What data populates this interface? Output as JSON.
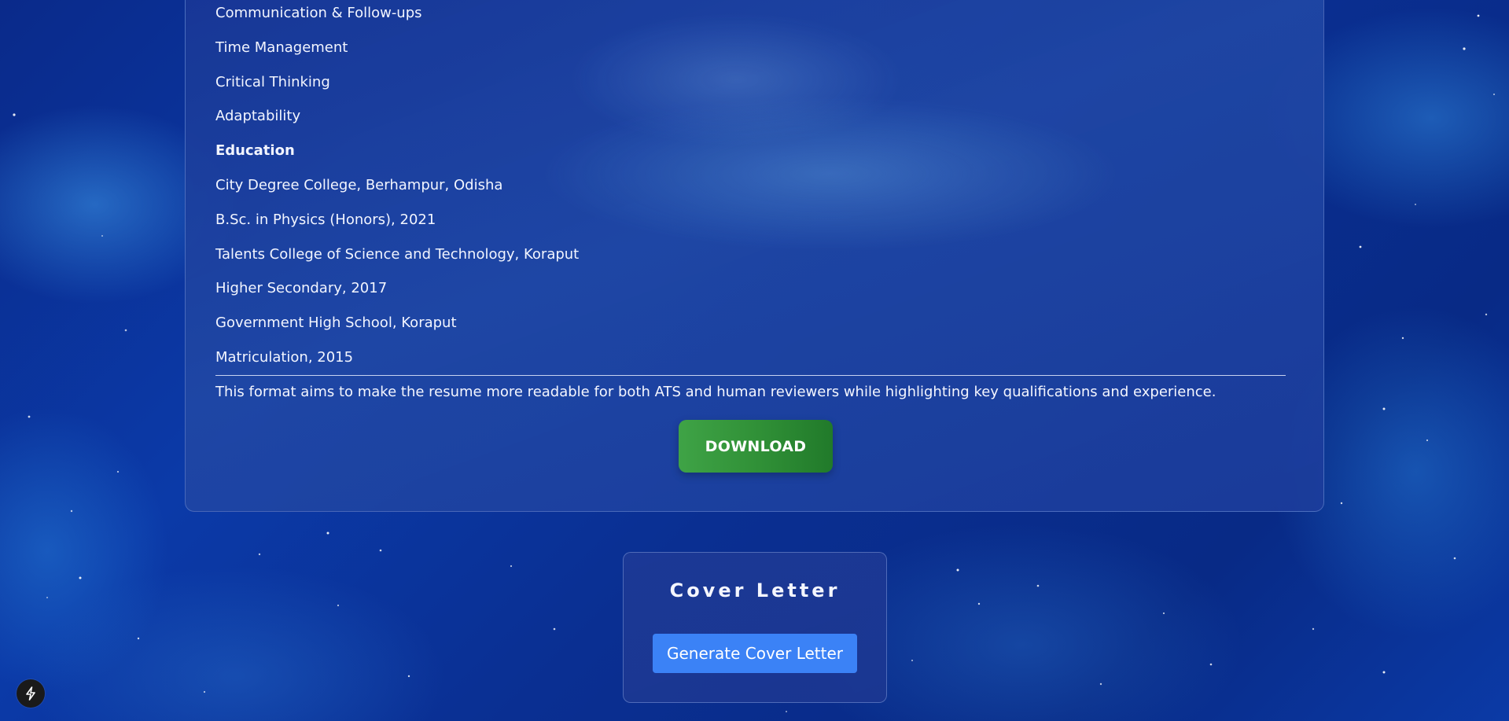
{
  "resume": {
    "lines": [
      {
        "text": "Communication & Follow-ups",
        "bold": false
      },
      {
        "text": "Time Management",
        "bold": false
      },
      {
        "text": "Critical Thinking",
        "bold": false
      },
      {
        "text": "Adaptability",
        "bold": false
      },
      {
        "text": "Education",
        "bold": true
      },
      {
        "text": "City Degree College, Berhampur, Odisha",
        "bold": false
      },
      {
        "text": "B.Sc. in Physics (Honors), 2021",
        "bold": false
      },
      {
        "text": "Talents College of Science and Technology, Koraput",
        "bold": false
      },
      {
        "text": "Higher Secondary, 2017",
        "bold": false
      },
      {
        "text": "Government High School, Koraput",
        "bold": false
      },
      {
        "text": "Matriculation, 2015",
        "bold": false
      }
    ],
    "note": "This format aims to make the resume more readable for both ATS and human reviewers while highlighting key qualifications and experience.",
    "download_label": "DOWNLOAD"
  },
  "cover_letter": {
    "title": "Cover Letter",
    "generate_label": "Generate Cover Letter"
  },
  "corner_button": {
    "icon": "lightning-bolt-icon"
  },
  "colors": {
    "background": "#0b3aa8",
    "download_button": "#2f8f36",
    "generate_button": "#3b82f6"
  }
}
